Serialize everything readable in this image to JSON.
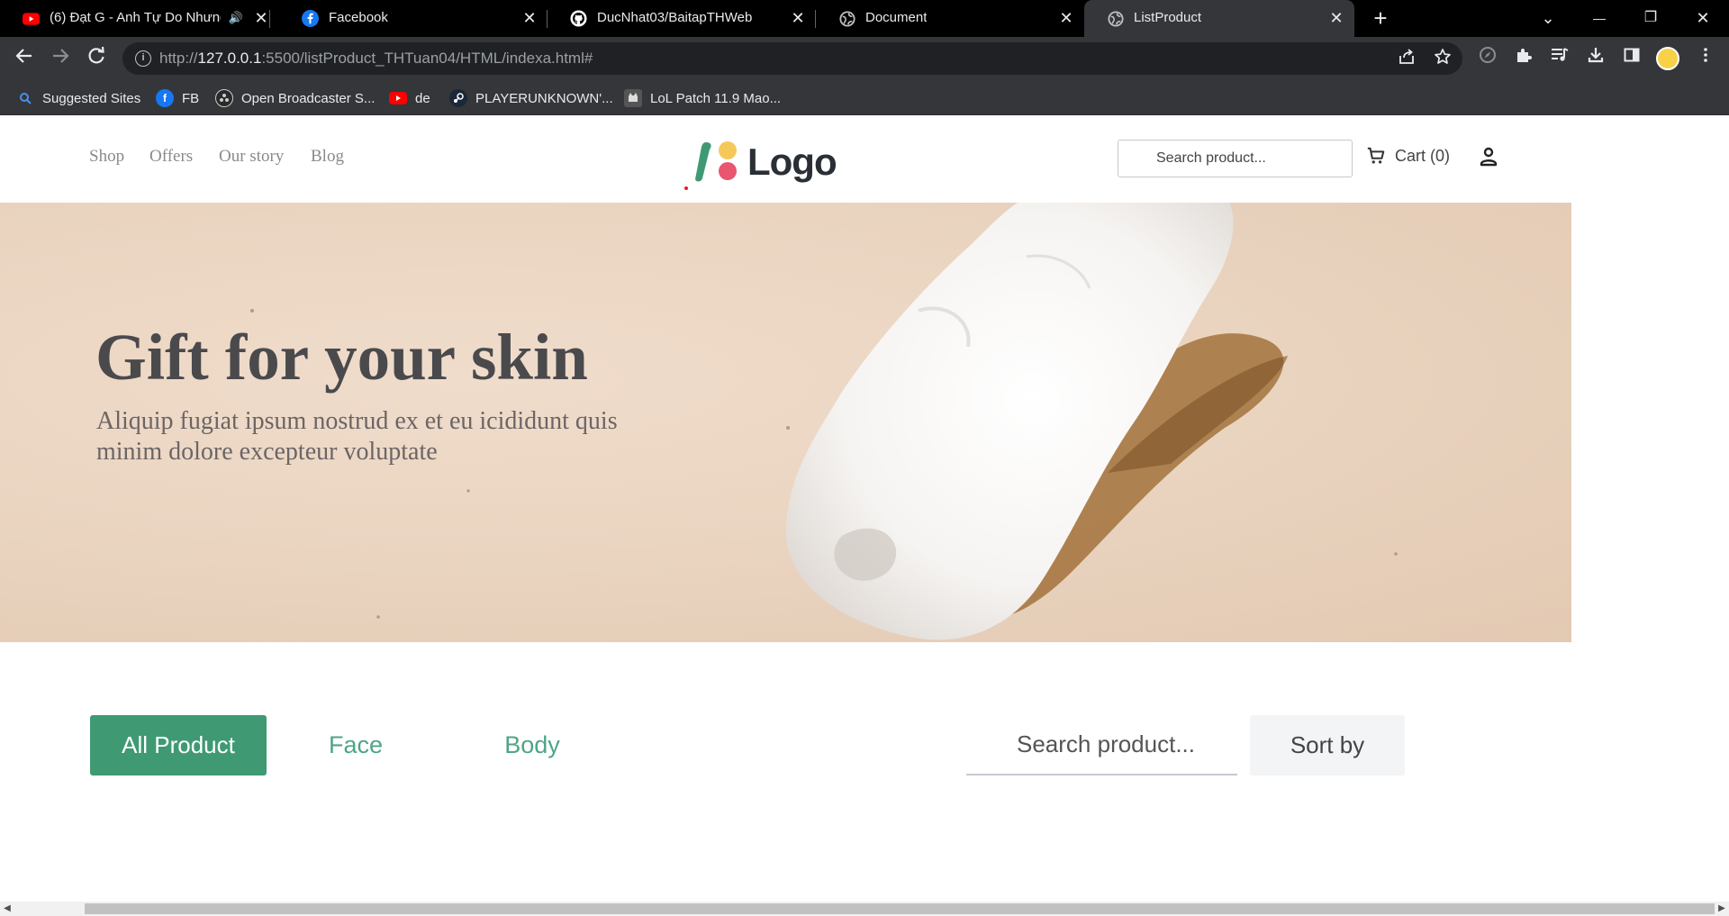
{
  "browser": {
    "tabs": [
      {
        "title": "(6) Đạt G - Anh Tự Do Nhưng",
        "icon": "youtube-icon",
        "audio": "🔊",
        "close": "✕"
      },
      {
        "title": "Facebook",
        "icon": "facebook-icon",
        "close": "✕"
      },
      {
        "title": "DucNhat03/BaitapTHWeb",
        "icon": "github-icon",
        "close": "✕"
      },
      {
        "title": "Document",
        "icon": "globe-icon",
        "close": "✕"
      },
      {
        "title": "ListProduct",
        "icon": "globe-icon",
        "close": "✕",
        "active": true
      }
    ],
    "new_tab": "+",
    "window_controls": {
      "dropdown": "⌄",
      "minimize": "—",
      "restore": "❐",
      "close": "✕"
    },
    "address": {
      "prefix": "http://",
      "host": "127.0.0.1",
      "rest": ":5500/listProduct_THTuan04/HTML/indexa.html#"
    },
    "bookmarks": [
      {
        "label": "Suggested Sites",
        "icon": "search-icon"
      },
      {
        "label": "FB",
        "icon": "facebook-icon"
      },
      {
        "label": "Open Broadcaster S...",
        "icon": "obs-icon"
      },
      {
        "label": "de",
        "icon": "youtube-icon"
      },
      {
        "label": "PLAYERUNKNOWN'...",
        "icon": "steam-icon"
      },
      {
        "label": "LoL Patch 11.9 Mao...",
        "icon": "cat-icon"
      }
    ]
  },
  "site": {
    "nav": [
      "Shop",
      "Offers",
      "Our story",
      "Blog"
    ],
    "logo": "Logo",
    "header_search_placeholder": "Search product...",
    "cart": "Cart (0)",
    "hero": {
      "title": "Gift for your skin",
      "subtitle": "Aliquip fugiat ipsum nostrud ex et eu icididunt quis minim dolore excepteur voluptate"
    },
    "filters": [
      "All Product",
      "Face",
      "Body"
    ],
    "product_search_placeholder": "Search product...",
    "sort": "Sort by"
  },
  "colors": {
    "accent": "#3f9a74",
    "accent_text": "#4fa585",
    "hero_bg": "#ead5c1"
  }
}
